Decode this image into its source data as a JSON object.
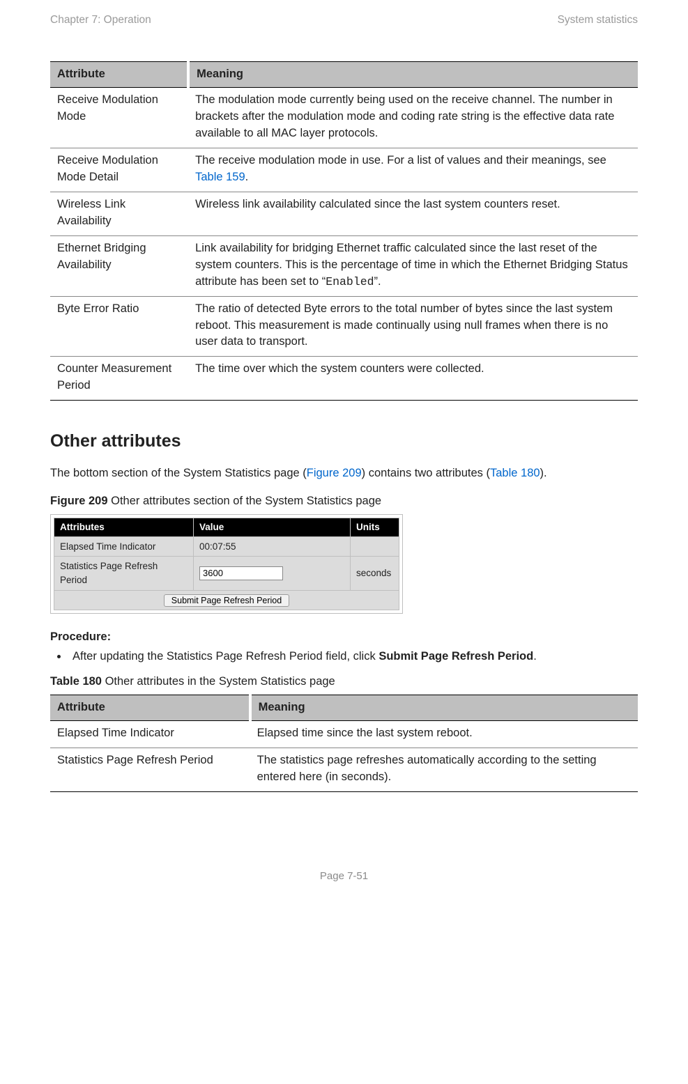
{
  "header": {
    "left": "Chapter 7:  Operation",
    "right": "System statistics"
  },
  "table1": {
    "head": {
      "attr": "Attribute",
      "meaning": "Meaning"
    },
    "rows": [
      {
        "attr": "Receive Modulation Mode",
        "meaning": "The modulation mode currently being used on the receive channel. The number in brackets after the modulation mode and coding rate string is the effective data rate available to all MAC layer protocols."
      },
      {
        "attr": "Receive Modulation Mode Detail",
        "m_pre": "The receive modulation mode in use. For a list of values and their meanings, see ",
        "m_link": "Table 159",
        "m_post": "."
      },
      {
        "attr": "Wireless Link Availability",
        "meaning": "Wireless link availability calculated since the last system counters reset."
      },
      {
        "attr": "Ethernet Bridging Availability",
        "m_pre": "Link availability for bridging Ethernet traffic calculated since the last reset of the system counters. This is the percentage of time in which the Ethernet Bridging Status attribute has been set to “",
        "m_mono": "Enabled",
        "m_post": "”."
      },
      {
        "attr": "Byte Error Ratio",
        "meaning": "The ratio of detected Byte errors to the total number of bytes since the last system reboot. This measurement is made continually using null frames when there is no user data to transport."
      },
      {
        "attr": "Counter Measurement Period",
        "meaning": "The time over which the system counters were collected."
      }
    ]
  },
  "section_heading": "Other attributes",
  "intro": {
    "pre": "The bottom section of the System Statistics page (",
    "link1": "Figure 209",
    "mid": ") contains two attributes (",
    "link2": "Table 180",
    "post": ")."
  },
  "fig_caption": {
    "label": "Figure 209",
    "text": " Other attributes section of the System Statistics page"
  },
  "figure": {
    "head": {
      "c1": "Attributes",
      "c2": "Value",
      "c3": "Units"
    },
    "row1": {
      "c1": "Elapsed Time Indicator",
      "c2": "00:07:55",
      "c3": ""
    },
    "row2": {
      "c1": "Statistics Page Refresh Period",
      "value": "3600",
      "c3": "seconds"
    },
    "button": "Submit Page Refresh Period"
  },
  "procedure": {
    "label": "Procedure:",
    "item_pre": "After updating the Statistics Page Refresh Period field, click ",
    "item_bold": "Submit Page Refresh Period",
    "item_post": "."
  },
  "t180_caption": {
    "label": "Table 180",
    "text": "  Other attributes in the System Statistics page"
  },
  "table180": {
    "head": {
      "attr": "Attribute",
      "meaning": "Meaning"
    },
    "rows": [
      {
        "attr": "Elapsed Time Indicator",
        "meaning": "Elapsed time since the last system reboot."
      },
      {
        "attr": "Statistics Page Refresh Period",
        "meaning": "The statistics page refreshes automatically according to the setting entered here (in seconds)."
      }
    ]
  },
  "footer": "Page 7-51"
}
